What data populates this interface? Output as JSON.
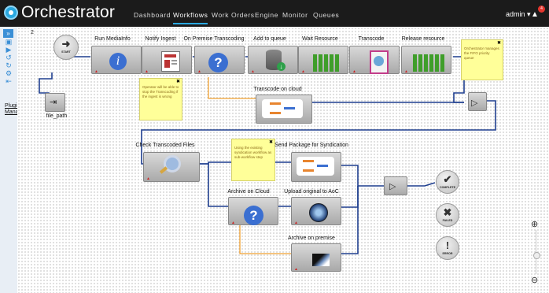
{
  "app": {
    "title": "Orchestrator"
  },
  "nav": {
    "items": [
      "Dashboard",
      "Workflows",
      "Work Orders",
      "Engine",
      "Monitor",
      "Queues"
    ],
    "active": "Workflows"
  },
  "user": {
    "name": "admin ▾",
    "notifications": "4"
  },
  "sidebar": {
    "toggle": "»",
    "plugin_label": "Plugin Manag"
  },
  "canvas": {
    "page_number": "2"
  },
  "nodes": {
    "start": "START",
    "file_path": "file_path",
    "run_mediainfo": "Run MediaInfo",
    "notify_ingest": "Notify Ingest",
    "on_premise_transcoding": "On Premise Transcoding",
    "add_to_queue": "Add to queue",
    "wait_resource": "Wait Resource",
    "transcode": "Transcode",
    "release_resource": "Release resource",
    "transcode_on_cloud": "Transcode on cloud",
    "check_transcoded_files": "Check Transcoded Files",
    "send_package": "Send Package for Syndication",
    "archive_on_cloud": "Archive on Cloud",
    "upload_original": "Upload original to AoC",
    "archive_on_premise": "Archive on premise",
    "complete": "COMPLETE",
    "failed": "FAILED",
    "error": "ERROR"
  },
  "notes": {
    "priority_queue": "Orchestrator manages the FIFO priority queue",
    "operator_stop": "Operator will be able to stop the Transcoding if the ingest is wrong",
    "syndication": "Using the existing syndication workflow as sub-workflow step"
  },
  "zoom": {
    "plus": "⊕",
    "minus": "⊖"
  },
  "colors": {
    "link": "#1f3f8f",
    "fail_link": "#f0a030",
    "accent": "#29a8e0",
    "note": "#ffff99"
  }
}
